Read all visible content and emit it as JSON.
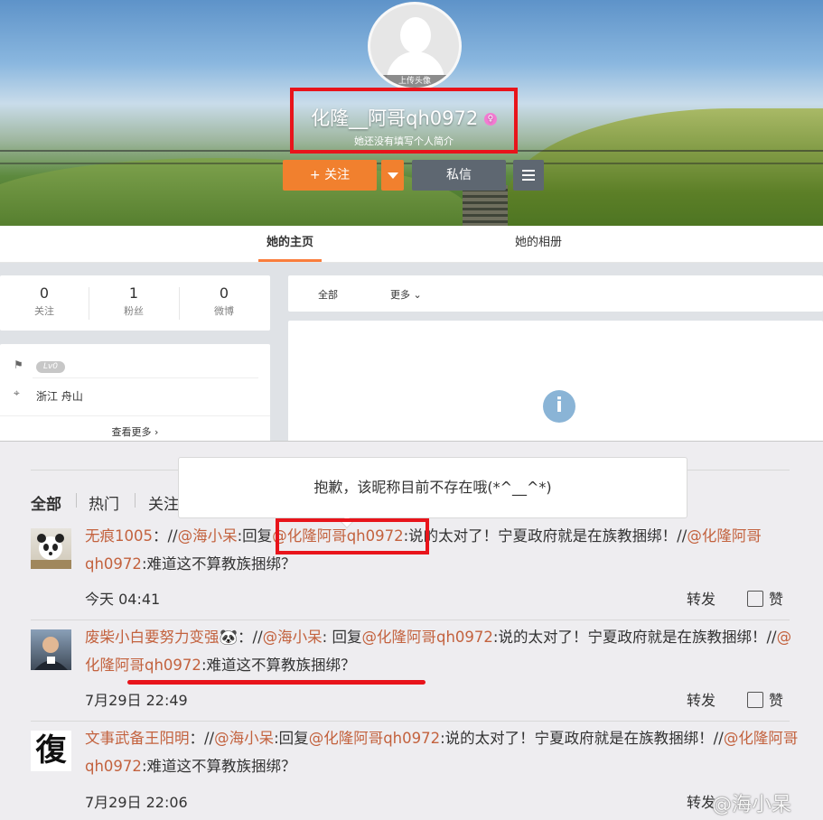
{
  "profile": {
    "upload_avatar_label": "上传头像",
    "name": "化隆__阿哥qh0972",
    "gender_icon": "female-icon",
    "intro": "她还没有填写个人简介",
    "follow_label": "+ 关注",
    "message_label": "私信"
  },
  "tabs": [
    {
      "label": "她的主页",
      "active": true
    },
    {
      "label": "她的相册",
      "active": false
    }
  ],
  "stats": [
    {
      "num": "0",
      "label": "关注"
    },
    {
      "num": "1",
      "label": "粉丝"
    },
    {
      "num": "0",
      "label": "微博"
    }
  ],
  "info": {
    "level": "Lv0",
    "location": "浙江 舟山",
    "more_label": "查看更多 ›"
  },
  "feed_filter": {
    "all": "全部",
    "more": "更多 ⌄"
  },
  "comment_tabs": [
    "全部",
    "热门",
    "关注"
  ],
  "toast": "抱歉，该昵称目前不存在哦(*^__^*)",
  "comments": [
    {
      "user": "无痕1005",
      "text": [
        {
          "t": "无痕1005",
          "u": true
        },
        {
          "t": "：//",
          "u": false
        },
        {
          "t": "@海小呆",
          "u": true
        },
        {
          "t": ":回复",
          "u": false
        },
        {
          "t": "@化隆阿哥qh0972",
          "u": true
        },
        {
          "t": ":说的太对了！宁夏政府就是在族教捆绑！//",
          "u": false
        },
        {
          "t": "@化隆阿哥qh0972",
          "u": true
        },
        {
          "t": ":难道这不算教族捆绑？",
          "u": false
        }
      ],
      "time": "今天 04:41"
    },
    {
      "user": "废柴小白要努力变强",
      "text": [
        {
          "t": "废柴小白要努力变强",
          "u": true
        },
        {
          "t": "🐼：//",
          "u": false
        },
        {
          "t": "@海小呆",
          "u": true
        },
        {
          "t": ": 回复",
          "u": false
        },
        {
          "t": "@化隆阿哥qh0972",
          "u": true
        },
        {
          "t": ":说的太对了！宁夏政府就是在族教捆绑！//",
          "u": false
        },
        {
          "t": "@化隆阿哥qh0972",
          "u": true
        },
        {
          "t": ":难道这不算教族捆绑？",
          "u": false
        }
      ],
      "time": "7月29日 22:49"
    },
    {
      "user": "文事武备王阳明",
      "text": [
        {
          "t": "文事武备王阳明",
          "u": true
        },
        {
          "t": "：//",
          "u": false
        },
        {
          "t": "@海小呆",
          "u": true
        },
        {
          "t": ":回复",
          "u": false
        },
        {
          "t": "@化隆阿哥qh0972",
          "u": true
        },
        {
          "t": ":说的太对了！宁夏政府就是在族教捆绑！//",
          "u": false
        },
        {
          "t": "@化隆阿哥qh0972",
          "u": true
        },
        {
          "t": ":难道这不算教族捆绑？",
          "u": false
        }
      ],
      "time": "7月29日 22:06"
    }
  ],
  "actions": {
    "forward": "转发",
    "like": "赞"
  },
  "watermark": "@海小呆",
  "colors": {
    "accent": "#f1802e",
    "mention": "#c3623e",
    "highlight": "#e8141b",
    "tab_underline": "#fa7d3c"
  }
}
